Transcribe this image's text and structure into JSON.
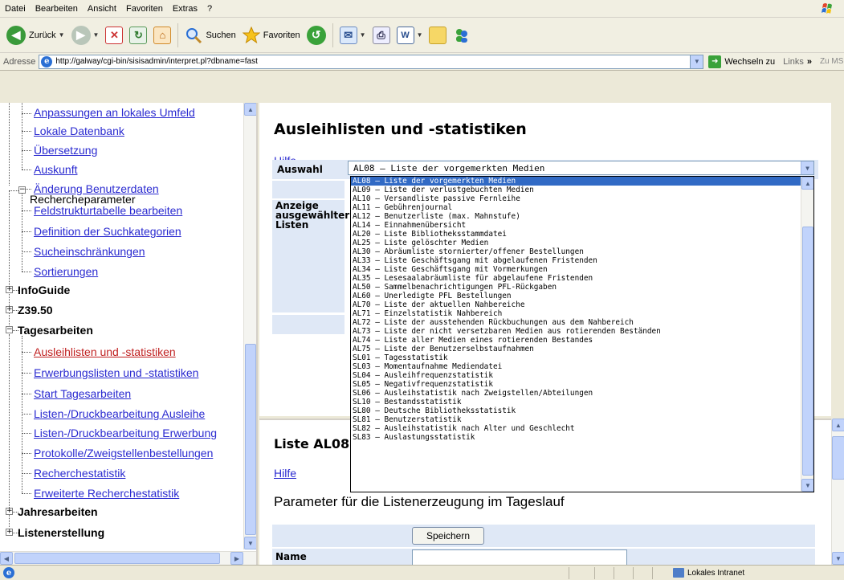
{
  "menubar": {
    "items": [
      "Datei",
      "Bearbeiten",
      "Ansicht",
      "Favoriten",
      "Extras",
      "?"
    ]
  },
  "toolbar": {
    "back_label": "Zurück",
    "search_label": "Suchen",
    "favorites_label": "Favoriten"
  },
  "addressbar": {
    "label": "Adresse",
    "url": "http://galway/cgi-bin/sisisadmin/interpret.pl?dbname=fast",
    "go_label": "Wechseln zu",
    "links_label": "Links",
    "links_more": "»",
    "extra_label": "Zu MS"
  },
  "sidebar": {
    "items": [
      {
        "label": "Anpassungen an lokales Umfeld",
        "kind": "link"
      },
      {
        "label": "Lokale Datenbank",
        "kind": "link"
      },
      {
        "label": "Übersetzung",
        "kind": "link"
      },
      {
        "label": "Auskunft",
        "kind": "link"
      },
      {
        "label": "Änderung Benutzerdaten",
        "kind": "link"
      },
      {
        "label": "Rechercheparameter",
        "kind": "node"
      },
      {
        "label": "Feldstrukturtabelle bearbeiten",
        "kind": "link"
      },
      {
        "label": "Definition der Suchkategorien",
        "kind": "link"
      },
      {
        "label": "Sucheinschränkungen",
        "kind": "link"
      },
      {
        "label": "Sortierungen",
        "kind": "link"
      },
      {
        "label": "InfoGuide",
        "kind": "head"
      },
      {
        "label": "Z39.50",
        "kind": "head"
      },
      {
        "label": "Tagesarbeiten",
        "kind": "head"
      },
      {
        "label": "Ausleihlisten und -statistiken",
        "kind": "link-active"
      },
      {
        "label": "Erwerbungslisten und -statistiken",
        "kind": "link"
      },
      {
        "label": "Start Tagesarbeiten",
        "kind": "link"
      },
      {
        "label": "Listen-/Druckbearbeitung Ausleihe",
        "kind": "link"
      },
      {
        "label": "Listen-/Druckbearbeitung Erwerbung",
        "kind": "link"
      },
      {
        "label": "Protokolle/Zweigstellenbestellungen",
        "kind": "link"
      },
      {
        "label": "Recherchestatistik",
        "kind": "link"
      },
      {
        "label": "Erweiterte Recherchestatistik",
        "kind": "link"
      },
      {
        "label": "Jahresarbeiten",
        "kind": "head"
      },
      {
        "label": "Listenerstellung",
        "kind": "head"
      }
    ],
    "expander_minus": "−",
    "expander_plus": "+"
  },
  "main": {
    "title": "Ausleihlisten und -statistiken",
    "help_label": "Hilfe",
    "auswahl_label": "Auswahl",
    "anzeige_label": "Anzeige ausgewählter Listen",
    "selected_value": "AL08 – Liste der vorgemerkten Medien",
    "options": [
      "AL08 – Liste der vorgemerkten Medien",
      "AL09 – Liste der verlustgebuchten Medien",
      "AL10 – Versandliste passive Fernleihe",
      "AL11 – Gebührenjournal",
      "AL12 – Benutzerliste (max. Mahnstufe)",
      "AL14 – Einnahmenübersicht",
      "AL20 – Liste Bibliotheksstammdatei",
      "AL25 – Liste gelöschter Medien",
      "AL30 – Abräumliste stornierter/offener Bestellungen",
      "AL33 – Liste Geschäftsgang mit abgelaufenen Fristenden",
      "AL34 – Liste Geschäftsgang mit Vormerkungen",
      "AL35 – Lesesaalabräumliste für abgelaufene Fristenden",
      "AL50 – Sammelbenachrichtigungen PFL-Rückgaben",
      "AL60 – Unerledigte PFL Bestellungen",
      "AL70 – Liste der aktuellen Nahbereiche",
      "AL71 – Einzelstatistik Nahbereich",
      "AL72 – Liste der ausstehenden Rückbuchungen aus dem Nahbereich",
      "AL73 – Liste der nicht versetzbaren Medien aus rotierenden Beständen",
      "AL74 – Liste aller Medien eines rotierenden Bestandes",
      "AL75 – Liste der Benutzerselbstaufnahmen",
      "SL01 – Tagesstatistik",
      "SL03 – Momentaufnahme Mediendatei",
      "SL04 – Ausleihfrequenzstatistik",
      "SL05 – Negativfrequenzstatistik",
      "SL06 – Ausleihstatistik nach Zweigstellen/Abteilungen",
      "SL10 – Bestandsstatistik",
      "SL80 – Deutsche Bibliotheksstatistik",
      "SL81 – Benutzerstatistik",
      "SL82 – Ausleihstatistik nach Alter und Geschlecht",
      "SL83 – Auslastungsstatistik"
    ]
  },
  "lower": {
    "title": "Liste AL08",
    "help_label": "Hilfe",
    "subheading": "Parameter für die Listenerzeugung im Tageslauf",
    "save_label": "Speichern",
    "name_label": "Name"
  },
  "statusbar": {
    "zone_label": "Lokales Intranet"
  },
  "colors": {
    "link": "#2a2ad0",
    "active_link": "#c02020",
    "selection": "#316ac5",
    "param_bg": "#dfe8f6"
  }
}
